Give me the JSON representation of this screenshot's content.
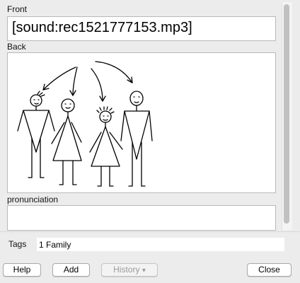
{
  "fields": {
    "front": {
      "label": "Front",
      "value": "[sound:rec1521777153.mp3]"
    },
    "back": {
      "label": "Back"
    },
    "pronunciation": {
      "label": "pronunciation",
      "value": ""
    }
  },
  "tags": {
    "label": "Tags",
    "value": "1 Family"
  },
  "buttons": {
    "help": "Help",
    "add": "Add",
    "history": "History",
    "history_arrow": "▾",
    "close": "Close"
  }
}
